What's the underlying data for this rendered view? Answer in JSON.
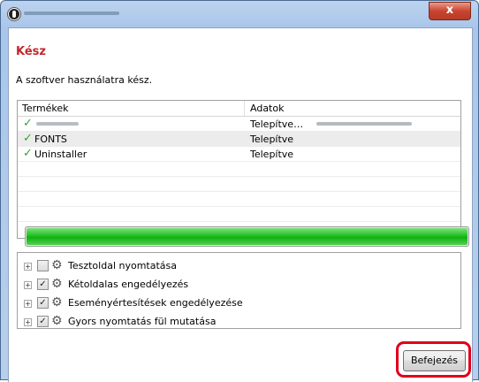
{
  "window": {
    "close_glyph": "x"
  },
  "header": {
    "title": "Kész",
    "subtitle": "A szoftver használatra kész."
  },
  "products_list": {
    "columns": [
      "Termékek",
      "Adatok"
    ],
    "rows": [
      {
        "product": "",
        "status": "Telepítve…",
        "check_icon": "checkmark-icon"
      },
      {
        "product": "FONTS",
        "status": "Telepítve",
        "check_icon": "checkmark-icon"
      },
      {
        "product": "Uninstaller",
        "status": "Telepítve",
        "check_icon": "checkmark-icon"
      }
    ]
  },
  "progress": {
    "value": 1.0,
    "color": "#21c021"
  },
  "options": [
    {
      "label": "Tesztoldal nyomtatása",
      "checked": false
    },
    {
      "label": "Kétoldalas engedélyezés",
      "checked": true
    },
    {
      "label": "Eseményértesítések engedélyezése",
      "checked": true
    },
    {
      "label": "Gyors nyomtatás fül mutatása",
      "checked": true
    }
  ],
  "footer": {
    "finish_label": "Befejezés",
    "highlight_color": "#e0001b"
  }
}
